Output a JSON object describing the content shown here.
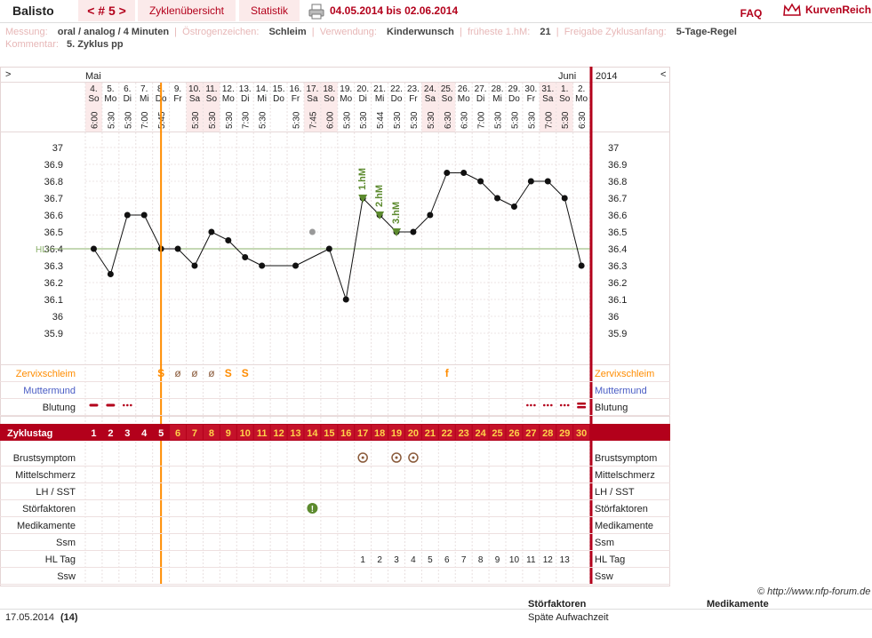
{
  "header": {
    "user": "Balisto",
    "cycle_nav": "< # 5 >",
    "tab_overview": "Zyklenübersicht",
    "tab_stats": "Statistik",
    "date_range": "04.05.2014 bis 02.06.2014",
    "faq": "FAQ",
    "brand": "KurvenReich"
  },
  "info": {
    "messung_label": "Messung:",
    "messung_value": "oral / analog / 4 Minuten",
    "oestro_label": "Östrogenzeichen:",
    "oestro_value": "Schleim",
    "verw_label": "Verwendung:",
    "verw_value": "Kinderwunsch",
    "hm_label": "früheste 1.hM:",
    "hm_value": "21",
    "freigabe_label": "Freigabe Zyklusanfang:",
    "freigabe_value": "5-Tage-Regel",
    "komm_label": "Kommentar:",
    "komm_value": "5. Zyklus pp"
  },
  "colors": {
    "brand": "#b3001b",
    "orange": "#ff8c00",
    "green": "#5c8a2e",
    "blue": "#4a5cc4",
    "pink_bg": "#fbeaea"
  },
  "chart_data": {
    "type": "line",
    "months": [
      "Mai",
      "Juni"
    ],
    "year": "2014",
    "dates": [
      "4.",
      "5.",
      "6.",
      "7.",
      "8.",
      "9.",
      "10.",
      "11.",
      "12.",
      "13.",
      "14.",
      "15.",
      "16.",
      "17.",
      "18.",
      "19.",
      "20.",
      "21.",
      "22.",
      "23.",
      "24.",
      "25.",
      "26.",
      "27.",
      "28.",
      "29.",
      "30.",
      "31.",
      "1.",
      "2."
    ],
    "weekdays": [
      "So",
      "Mo",
      "Di",
      "Mi",
      "Do",
      "Fr",
      "Sa",
      "So",
      "Mo",
      "Di",
      "Mi",
      "Do",
      "Fr",
      "Sa",
      "So",
      "Mo",
      "Di",
      "Mi",
      "Do",
      "Fr",
      "Sa",
      "So",
      "Mo",
      "Di",
      "Mi",
      "Do",
      "Fr",
      "Sa",
      "So",
      "Mo"
    ],
    "times": [
      "6:00",
      "5:30",
      "5:30",
      "7:00",
      "5:45",
      "",
      "5:30",
      "5:30",
      "5:30",
      "7:30",
      "5:30",
      "",
      "5:30",
      "7:45",
      "6:00",
      "5:30",
      "5:30",
      "5:44",
      "5:30",
      "5:30",
      "5:30",
      "6:30",
      "6:30",
      "7:00",
      "5:30",
      "5:30",
      "5:30",
      "7:00",
      "5:30",
      "6:30"
    ],
    "temps": [
      36.4,
      36.25,
      36.6,
      36.6,
      36.4,
      36.4,
      36.3,
      36.5,
      36.45,
      36.35,
      36.3,
      null,
      36.3,
      36.5,
      36.4,
      36.1,
      36.7,
      36.6,
      36.5,
      36.5,
      36.6,
      36.85,
      36.85,
      36.8,
      36.7,
      36.65,
      36.8,
      36.8,
      36.7,
      36.3
    ],
    "excluded": [
      13
    ],
    "ylim": [
      35.9,
      37.0
    ],
    "yticks": [
      "37",
      "36.9",
      "36.8",
      "36.7",
      "36.6",
      "36.5",
      "36.4",
      "36.3",
      "36.2",
      "36.1",
      "36",
      "35.9"
    ],
    "cover_line": 36.4,
    "cover_label": "HLi",
    "hm_labels": [
      "1.hM",
      "2.hM",
      "3.hM"
    ],
    "hm_days": [
      16,
      17,
      18
    ],
    "marker_day": 4,
    "end_day": 29,
    "row_labels": {
      "schleim": "Zervixschleim",
      "muttermund": "Muttermund",
      "blutung": "Blutung",
      "zyklustag": "Zyklustag",
      "brust": "Brustsymptom",
      "mittel": "Mittelschmerz",
      "lh": "LH / SST",
      "stoer": "Störfaktoren",
      "medi": "Medikamente",
      "ssm": "Ssm",
      "hltag": "HL Tag",
      "ssw": "Ssw"
    },
    "schleim": [
      "",
      "",
      "",
      "",
      "S",
      "ø",
      "ø",
      "ø",
      "S",
      "S",
      "",
      "",
      "",
      "",
      "",
      "",
      "",
      "",
      "",
      "",
      "",
      "f",
      "",
      "",
      "",
      "",
      "",
      "",
      "",
      ""
    ],
    "blutung": [
      "dash",
      "dash",
      "dots",
      "",
      "",
      "",
      "",
      "",
      "",
      "",
      "",
      "",
      "",
      "",
      "",
      "",
      "",
      "",
      "",
      "",
      "",
      "",
      "",
      "",
      "",
      "",
      "dots",
      "dots",
      "dots",
      "double"
    ],
    "zyklustag": [
      "1",
      "2",
      "3",
      "4",
      "5",
      "6",
      "7",
      "8",
      "9",
      "10",
      "11",
      "12",
      "13",
      "14",
      "15",
      "16",
      "17",
      "18",
      "19",
      "20",
      "21",
      "22",
      "23",
      "24",
      "25",
      "26",
      "27",
      "28",
      "29",
      "30"
    ],
    "brust_days": [
      16,
      18,
      19
    ],
    "stoer_days": [
      13
    ],
    "hl_tag": [
      "",
      "",
      "",
      "",
      "",
      "",
      "",
      "",
      "",
      "",
      "",
      "",
      "",
      "",
      "",
      "",
      "1",
      "2",
      "3",
      "4",
      "5",
      "6",
      "7",
      "8",
      "9",
      "10",
      "11",
      "12",
      "13",
      ""
    ],
    "nav_left": ">",
    "nav_right": "<"
  },
  "footer": {
    "copyright": "© http://www.nfp-forum.de",
    "date": "17.05.2014",
    "day": "(14)",
    "stoer_title": "Störfaktoren",
    "stoer_text": "Späte Aufwachzeit",
    "medi_title": "Medikamente"
  }
}
